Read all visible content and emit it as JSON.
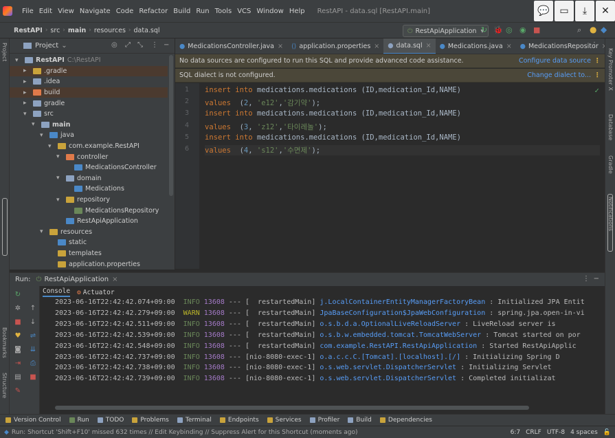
{
  "menu": {
    "items": [
      "File",
      "Edit",
      "View",
      "Navigate",
      "Code",
      "Refactor",
      "Build",
      "Run",
      "Tools",
      "VCS",
      "Window",
      "Help"
    ],
    "window_title": "RestAPI - data.sql [RestAPI.main]"
  },
  "breadcrumb": [
    "RestAPI",
    "src",
    "main",
    "resources",
    "data.sql"
  ],
  "run_config": "RestApiApplication",
  "project": {
    "header": "Project",
    "tree": [
      {
        "label": "RestAPI",
        "extra": "C:\\RestAPI",
        "depth": 0,
        "arrow": "▾",
        "color": "#8da2c0",
        "bold": true
      },
      {
        "label": ".gradle",
        "depth": 1,
        "arrow": "▸",
        "color": "#c9a33b",
        "selected": true
      },
      {
        "label": ".idea",
        "depth": 1,
        "arrow": "▸",
        "color": "#8da2c0"
      },
      {
        "label": "build",
        "depth": 1,
        "arrow": "▸",
        "color": "#e07a4a",
        "selected": true
      },
      {
        "label": "gradle",
        "depth": 1,
        "arrow": "▸",
        "color": "#8da2c0"
      },
      {
        "label": "src",
        "depth": 1,
        "arrow": "▾",
        "color": "#8da2c0"
      },
      {
        "label": "main",
        "depth": 2,
        "arrow": "▾",
        "color": "#8da2c0",
        "bold": true
      },
      {
        "label": "java",
        "depth": 3,
        "arrow": "▾",
        "color": "#4a88c7"
      },
      {
        "label": "com.example.RestAPI",
        "depth": 4,
        "arrow": "▾",
        "color": "#c9a33b"
      },
      {
        "label": "controller",
        "depth": 5,
        "arrow": "▾",
        "color": "#e07a4a"
      },
      {
        "label": "MedicationsController",
        "depth": 6,
        "arrow": "",
        "color": "#4a88c7"
      },
      {
        "label": "domain",
        "depth": 5,
        "arrow": "▾",
        "color": "#8da2c0"
      },
      {
        "label": "Medications",
        "depth": 6,
        "arrow": "",
        "color": "#4a88c7"
      },
      {
        "label": "repository",
        "depth": 5,
        "arrow": "▾",
        "color": "#c9a33b"
      },
      {
        "label": "MedicationsRepository",
        "depth": 6,
        "arrow": "",
        "color": "#6a8759"
      },
      {
        "label": "RestApiApplication",
        "depth": 5,
        "arrow": "",
        "color": "#4a88c7"
      },
      {
        "label": "resources",
        "depth": 3,
        "arrow": "▾",
        "color": "#c9a33b"
      },
      {
        "label": "static",
        "depth": 4,
        "arrow": "",
        "color": "#4a88c7"
      },
      {
        "label": "templates",
        "depth": 4,
        "arrow": "",
        "color": "#c9a33b"
      },
      {
        "label": "application.properties",
        "depth": 4,
        "arrow": "",
        "color": "#c9a33b"
      }
    ]
  },
  "editor": {
    "tabs": [
      {
        "label": "MedicationsController.java",
        "active": false
      },
      {
        "label": "application.properties",
        "active": false
      },
      {
        "label": "data.sql",
        "active": true
      },
      {
        "label": "Medications.java",
        "active": false
      },
      {
        "label": "MedicationsRepositor",
        "active": false
      }
    ],
    "banner1": {
      "text": "No data sources are configured to run this SQL and provide advanced code assistance.",
      "action": "Configure data source"
    },
    "banner2": {
      "text": "SQL dialect is not configured.",
      "action": "Change dialect to..."
    },
    "lines": [
      {
        "n": "1",
        "kw": "insert into",
        "rest": " medications.medications (ID,medication_Id,NAME)"
      },
      {
        "n": "2",
        "kw": "values",
        "num": "2",
        "str1": "'e12'",
        "str2": "'감기약'"
      },
      {
        "n": "3",
        "kw": "insert into",
        "rest": " medications.medications (ID,medication_Id,NAME)"
      },
      {
        "n": "4",
        "kw": "values",
        "num": "3",
        "str1": "'z12'",
        "str2": "'타이레놀'"
      },
      {
        "n": "5",
        "kw": "insert into",
        "rest": " medications.medications (ID,medication_Id,NAME)"
      },
      {
        "n": "6",
        "kw": "values",
        "num": "4",
        "str1": "'s12'",
        "str2": "'수면제'"
      }
    ]
  },
  "run": {
    "title": "Run:",
    "config": "RestApiApplication",
    "tabs": [
      "Console",
      "Actuator"
    ],
    "log": [
      {
        "ts": "2023-06-16T22:42:42.074+09:00",
        "level": "INFO",
        "pid": "13608",
        "thread": "  restartedMain]",
        "logger": "j.LocalContainerEntityManagerFactoryBean",
        "msg": ": Initialized JPA Entit"
      },
      {
        "ts": "2023-06-16T22:42:42.279+09:00",
        "level": "WARN",
        "pid": "13608",
        "thread": "  restartedMain]",
        "logger": "JpaBaseConfiguration$JpaWebConfiguration",
        "msg": ": spring.jpa.open-in-vi"
      },
      {
        "ts": "2023-06-16T22:42:42.511+09:00",
        "level": "INFO",
        "pid": "13608",
        "thread": "  restartedMain]",
        "logger": "o.s.b.d.a.OptionalLiveReloadServer",
        "msg": ": LiveReload server is"
      },
      {
        "ts": "2023-06-16T22:42:42.539+09:00",
        "level": "INFO",
        "pid": "13608",
        "thread": "  restartedMain]",
        "logger": "o.s.b.w.embedded.tomcat.TomcatWebServer",
        "msg": ": Tomcat started on por"
      },
      {
        "ts": "2023-06-16T22:42:42.548+09:00",
        "level": "INFO",
        "pid": "13608",
        "thread": "  restartedMain]",
        "logger": "com.example.RestAPI.RestApiApplication",
        "msg": ": Started RestApiApplic"
      },
      {
        "ts": "2023-06-16T22:42:42.737+09:00",
        "level": "INFO",
        "pid": "13608",
        "thread": "[nio-8080-exec-1]",
        "logger": "o.a.c.c.C.[Tomcat].[localhost].[/]",
        "msg": ": Initializing Spring D"
      },
      {
        "ts": "2023-06-16T22:42:42.738+09:00",
        "level": "INFO",
        "pid": "13608",
        "thread": "[nio-8080-exec-1]",
        "logger": "o.s.web.servlet.DispatcherServlet",
        "msg": ": Initializing Servlet"
      },
      {
        "ts": "2023-06-16T22:42:42.739+09:00",
        "level": "INFO",
        "pid": "13608",
        "thread": "[nio-8080-exec-1]",
        "logger": "o.s.web.servlet.DispatcherServlet",
        "msg": ": Completed initializat"
      }
    ]
  },
  "toolwindows": [
    {
      "label": "Version Control",
      "color": "#c9a33b"
    },
    {
      "label": "Run",
      "color": "#6a8759"
    },
    {
      "label": "TODO",
      "color": "#8da2c0"
    },
    {
      "label": "Problems",
      "color": "#c9a33b"
    },
    {
      "label": "Terminal",
      "color": "#8da2c0"
    },
    {
      "label": "Endpoints",
      "color": "#c9a33b"
    },
    {
      "label": "Services",
      "color": "#c9a33b"
    },
    {
      "label": "Profiler",
      "color": "#8da2c0"
    },
    {
      "label": "Build",
      "color": "#8da2c0"
    },
    {
      "label": "Dependencies",
      "color": "#c9a33b"
    }
  ],
  "status": {
    "message": "Run: Shortcut 'Shift+F10' missed 632 times // Edit Keybinding // Suppress Alert for this Shortcut (moments ago)",
    "position": "6:7",
    "line_sep": "CRLF",
    "encoding": "UTF-8",
    "indent": "4 spaces"
  },
  "side_labels": {
    "left": [
      "Project",
      "Bookmarks",
      "Structure"
    ],
    "right": [
      "Key Promoter X",
      "Database",
      "Gradle",
      "Notifications"
    ]
  }
}
